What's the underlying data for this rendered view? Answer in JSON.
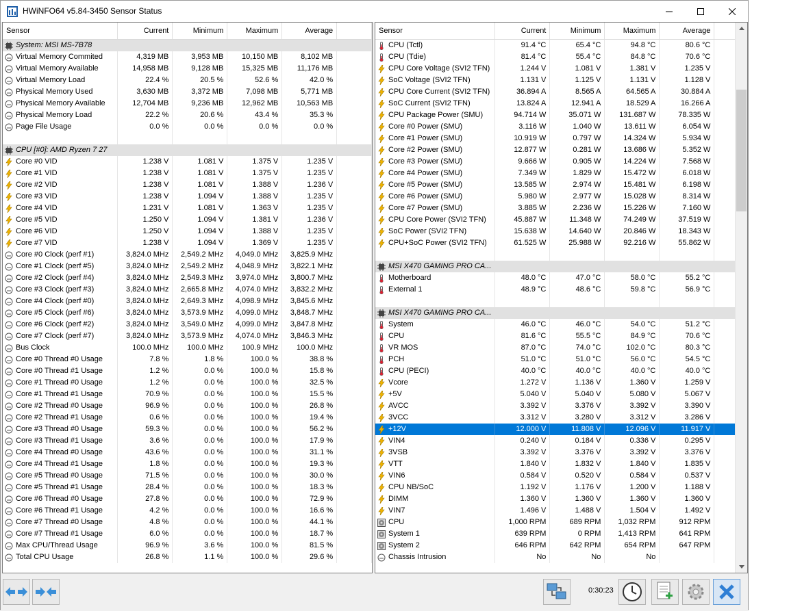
{
  "window": {
    "title": "HWiNFO64 v5.84-3450 Sensor Status",
    "icon": "hwinfo-app-icon",
    "controls": [
      "minimize",
      "maximize",
      "close"
    ]
  },
  "left_panel": {
    "columns": [
      "Sensor",
      "Current",
      "Minimum",
      "Maximum",
      "Average"
    ],
    "rows": [
      {
        "type": "group",
        "icon": "chip",
        "label": "System: MSI MS-7B78"
      },
      {
        "icon": "gauge",
        "label": "Virtual Memory Commited",
        "cur": "4,319 MB",
        "min": "3,953 MB",
        "max": "10,150 MB",
        "avg": "8,102 MB"
      },
      {
        "icon": "gauge",
        "label": "Virtual Memory Available",
        "cur": "14,958 MB",
        "min": "9,128 MB",
        "max": "15,325 MB",
        "avg": "11,176 MB"
      },
      {
        "icon": "gauge",
        "label": "Virtual Memory Load",
        "cur": "22.4 %",
        "min": "20.5 %",
        "max": "52.6 %",
        "avg": "42.0 %"
      },
      {
        "icon": "gauge",
        "label": "Physical Memory Used",
        "cur": "3,630 MB",
        "min": "3,372 MB",
        "max": "7,098 MB",
        "avg": "5,771 MB"
      },
      {
        "icon": "gauge",
        "label": "Physical Memory Available",
        "cur": "12,704 MB",
        "min": "9,236 MB",
        "max": "12,962 MB",
        "avg": "10,563 MB"
      },
      {
        "icon": "gauge",
        "label": "Physical Memory Load",
        "cur": "22.2 %",
        "min": "20.6 %",
        "max": "43.4 %",
        "avg": "35.3 %"
      },
      {
        "icon": "gauge",
        "label": "Page File Usage",
        "cur": "0.0 %",
        "min": "0.0 %",
        "max": "0.0 %",
        "avg": "0.0 %"
      },
      {
        "type": "blank"
      },
      {
        "type": "group",
        "icon": "chip",
        "label": "CPU [#0]: AMD Ryzen 7 27"
      },
      {
        "icon": "bolt",
        "label": "Core #0 VID",
        "cur": "1.238 V",
        "min": "1.081 V",
        "max": "1.375 V",
        "avg": "1.235 V"
      },
      {
        "icon": "bolt",
        "label": "Core #1 VID",
        "cur": "1.238 V",
        "min": "1.081 V",
        "max": "1.375 V",
        "avg": "1.235 V"
      },
      {
        "icon": "bolt",
        "label": "Core #2 VID",
        "cur": "1.238 V",
        "min": "1.081 V",
        "max": "1.388 V",
        "avg": "1.236 V"
      },
      {
        "icon": "bolt",
        "label": "Core #3 VID",
        "cur": "1.238 V",
        "min": "1.094 V",
        "max": "1.388 V",
        "avg": "1.235 V"
      },
      {
        "icon": "bolt",
        "label": "Core #4 VID",
        "cur": "1.231 V",
        "min": "1.081 V",
        "max": "1.363 V",
        "avg": "1.235 V"
      },
      {
        "icon": "bolt",
        "label": "Core #5 VID",
        "cur": "1.250 V",
        "min": "1.094 V",
        "max": "1.381 V",
        "avg": "1.236 V"
      },
      {
        "icon": "bolt",
        "label": "Core #6 VID",
        "cur": "1.250 V",
        "min": "1.094 V",
        "max": "1.388 V",
        "avg": "1.235 V"
      },
      {
        "icon": "bolt",
        "label": "Core #7 VID",
        "cur": "1.238 V",
        "min": "1.094 V",
        "max": "1.369 V",
        "avg": "1.235 V"
      },
      {
        "icon": "gauge",
        "label": "Core #0 Clock (perf #1)",
        "cur": "3,824.0 MHz",
        "min": "2,549.2 MHz",
        "max": "4,049.0 MHz",
        "avg": "3,825.9 MHz"
      },
      {
        "icon": "gauge",
        "label": "Core #1 Clock (perf #5)",
        "cur": "3,824.0 MHz",
        "min": "2,549.2 MHz",
        "max": "4,048.9 MHz",
        "avg": "3,822.1 MHz"
      },
      {
        "icon": "gauge",
        "label": "Core #2 Clock (perf #4)",
        "cur": "3,824.0 MHz",
        "min": "2,549.3 MHz",
        "max": "3,974.0 MHz",
        "avg": "3,800.7 MHz"
      },
      {
        "icon": "gauge",
        "label": "Core #3 Clock (perf #3)",
        "cur": "3,824.0 MHz",
        "min": "2,665.8 MHz",
        "max": "4,074.0 MHz",
        "avg": "3,832.2 MHz"
      },
      {
        "icon": "gauge",
        "label": "Core #4 Clock (perf #0)",
        "cur": "3,824.0 MHz",
        "min": "2,649.3 MHz",
        "max": "4,098.9 MHz",
        "avg": "3,845.6 MHz"
      },
      {
        "icon": "gauge",
        "label": "Core #5 Clock (perf #6)",
        "cur": "3,824.0 MHz",
        "min": "3,573.9 MHz",
        "max": "4,099.0 MHz",
        "avg": "3,848.7 MHz"
      },
      {
        "icon": "gauge",
        "label": "Core #6 Clock (perf #2)",
        "cur": "3,824.0 MHz",
        "min": "3,549.0 MHz",
        "max": "4,099.0 MHz",
        "avg": "3,847.8 MHz"
      },
      {
        "icon": "gauge",
        "label": "Core #7 Clock (perf #7)",
        "cur": "3,824.0 MHz",
        "min": "3,573.9 MHz",
        "max": "4,074.0 MHz",
        "avg": "3,846.3 MHz"
      },
      {
        "icon": "gauge",
        "label": "Bus Clock",
        "cur": "100.0 MHz",
        "min": "100.0 MHz",
        "max": "100.9 MHz",
        "avg": "100.0 MHz"
      },
      {
        "icon": "gauge",
        "label": "Core #0 Thread #0 Usage",
        "cur": "7.8 %",
        "min": "1.8 %",
        "max": "100.0 %",
        "avg": "38.8 %"
      },
      {
        "icon": "gauge",
        "label": "Core #0 Thread #1 Usage",
        "cur": "1.2 %",
        "min": "0.0 %",
        "max": "100.0 %",
        "avg": "15.8 %"
      },
      {
        "icon": "gauge",
        "label": "Core #1 Thread #0 Usage",
        "cur": "1.2 %",
        "min": "0.0 %",
        "max": "100.0 %",
        "avg": "32.5 %"
      },
      {
        "icon": "gauge",
        "label": "Core #1 Thread #1 Usage",
        "cur": "70.9 %",
        "min": "0.0 %",
        "max": "100.0 %",
        "avg": "15.5 %"
      },
      {
        "icon": "gauge",
        "label": "Core #2 Thread #0 Usage",
        "cur": "96.9 %",
        "min": "0.0 %",
        "max": "100.0 %",
        "avg": "26.8 %"
      },
      {
        "icon": "gauge",
        "label": "Core #2 Thread #1 Usage",
        "cur": "0.6 %",
        "min": "0.0 %",
        "max": "100.0 %",
        "avg": "19.4 %"
      },
      {
        "icon": "gauge",
        "label": "Core #3 Thread #0 Usage",
        "cur": "59.3 %",
        "min": "0.0 %",
        "max": "100.0 %",
        "avg": "56.2 %"
      },
      {
        "icon": "gauge",
        "label": "Core #3 Thread #1 Usage",
        "cur": "3.6 %",
        "min": "0.0 %",
        "max": "100.0 %",
        "avg": "17.9 %"
      },
      {
        "icon": "gauge",
        "label": "Core #4 Thread #0 Usage",
        "cur": "43.6 %",
        "min": "0.0 %",
        "max": "100.0 %",
        "avg": "31.1 %"
      },
      {
        "icon": "gauge",
        "label": "Core #4 Thread #1 Usage",
        "cur": "1.8 %",
        "min": "0.0 %",
        "max": "100.0 %",
        "avg": "19.3 %"
      },
      {
        "icon": "gauge",
        "label": "Core #5 Thread #0 Usage",
        "cur": "71.5 %",
        "min": "0.0 %",
        "max": "100.0 %",
        "avg": "30.0 %"
      },
      {
        "icon": "gauge",
        "label": "Core #5 Thread #1 Usage",
        "cur": "28.4 %",
        "min": "0.0 %",
        "max": "100.0 %",
        "avg": "18.3 %"
      },
      {
        "icon": "gauge",
        "label": "Core #6 Thread #0 Usage",
        "cur": "27.8 %",
        "min": "0.0 %",
        "max": "100.0 %",
        "avg": "72.9 %"
      },
      {
        "icon": "gauge",
        "label": "Core #6 Thread #1 Usage",
        "cur": "4.2 %",
        "min": "0.0 %",
        "max": "100.0 %",
        "avg": "16.6 %"
      },
      {
        "icon": "gauge",
        "label": "Core #7 Thread #0 Usage",
        "cur": "4.8 %",
        "min": "0.0 %",
        "max": "100.0 %",
        "avg": "44.1 %"
      },
      {
        "icon": "gauge",
        "label": "Core #7 Thread #1 Usage",
        "cur": "6.0 %",
        "min": "0.0 %",
        "max": "100.0 %",
        "avg": "18.7 %"
      },
      {
        "icon": "gauge",
        "label": "Max CPU/Thread Usage",
        "cur": "96.9 %",
        "min": "3.6 %",
        "max": "100.0 %",
        "avg": "81.5 %"
      },
      {
        "icon": "gauge",
        "label": "Total CPU Usage",
        "cur": "26.8 %",
        "min": "1.1 %",
        "max": "100.0 %",
        "avg": "29.6 %"
      }
    ]
  },
  "right_panel": {
    "columns": [
      "Sensor",
      "Current",
      "Minimum",
      "Maximum",
      "Average"
    ],
    "rows": [
      {
        "icon": "thermo",
        "label": "CPU (Tctl)",
        "cur": "91.4 °C",
        "min": "65.4 °C",
        "max": "94.8 °C",
        "avg": "80.6 °C"
      },
      {
        "icon": "thermo",
        "label": "CPU (Tdie)",
        "cur": "81.4 °C",
        "min": "55.4 °C",
        "max": "84.8 °C",
        "avg": "70.6 °C"
      },
      {
        "icon": "bolt",
        "label": "CPU Core Voltage (SVI2 TFN)",
        "cur": "1.244 V",
        "min": "1.081 V",
        "max": "1.381 V",
        "avg": "1.235 V"
      },
      {
        "icon": "bolt",
        "label": "SoC Voltage (SVI2 TFN)",
        "cur": "1.131 V",
        "min": "1.125 V",
        "max": "1.131 V",
        "avg": "1.128 V"
      },
      {
        "icon": "bolt",
        "label": "CPU Core Current (SVI2 TFN)",
        "cur": "36.894 A",
        "min": "8.565 A",
        "max": "64.565 A",
        "avg": "30.884 A"
      },
      {
        "icon": "bolt",
        "label": "SoC Current (SVI2 TFN)",
        "cur": "13.824 A",
        "min": "12.941 A",
        "max": "18.529 A",
        "avg": "16.266 A"
      },
      {
        "icon": "bolt",
        "label": "CPU Package Power (SMU)",
        "cur": "94.714 W",
        "min": "35.071 W",
        "max": "131.687 W",
        "avg": "78.335 W"
      },
      {
        "icon": "bolt",
        "label": "Core #0 Power (SMU)",
        "cur": "3.116 W",
        "min": "1.040 W",
        "max": "13.611 W",
        "avg": "6.054 W"
      },
      {
        "icon": "bolt",
        "label": "Core #1 Power (SMU)",
        "cur": "10.919 W",
        "min": "0.797 W",
        "max": "14.324 W",
        "avg": "5.934 W"
      },
      {
        "icon": "bolt",
        "label": "Core #2 Power (SMU)",
        "cur": "12.877 W",
        "min": "0.281 W",
        "max": "13.686 W",
        "avg": "5.352 W"
      },
      {
        "icon": "bolt",
        "label": "Core #3 Power (SMU)",
        "cur": "9.666 W",
        "min": "0.905 W",
        "max": "14.224 W",
        "avg": "7.568 W"
      },
      {
        "icon": "bolt",
        "label": "Core #4 Power (SMU)",
        "cur": "7.349 W",
        "min": "1.829 W",
        "max": "15.472 W",
        "avg": "6.018 W"
      },
      {
        "icon": "bolt",
        "label": "Core #5 Power (SMU)",
        "cur": "13.585 W",
        "min": "2.974 W",
        "max": "15.481 W",
        "avg": "6.198 W"
      },
      {
        "icon": "bolt",
        "label": "Core #6 Power (SMU)",
        "cur": "5.980 W",
        "min": "2.977 W",
        "max": "15.028 W",
        "avg": "8.314 W"
      },
      {
        "icon": "bolt",
        "label": "Core #7 Power (SMU)",
        "cur": "3.885 W",
        "min": "2.236 W",
        "max": "15.226 W",
        "avg": "7.160 W"
      },
      {
        "icon": "bolt",
        "label": "CPU Core Power (SVI2 TFN)",
        "cur": "45.887 W",
        "min": "11.348 W",
        "max": "74.249 W",
        "avg": "37.519 W"
      },
      {
        "icon": "bolt",
        "label": "SoC Power (SVI2 TFN)",
        "cur": "15.638 W",
        "min": "14.640 W",
        "max": "20.846 W",
        "avg": "18.343 W"
      },
      {
        "icon": "bolt",
        "label": "CPU+SoC Power (SVI2 TFN)",
        "cur": "61.525 W",
        "min": "25.988 W",
        "max": "92.216 W",
        "avg": "55.862 W"
      },
      {
        "type": "blank"
      },
      {
        "type": "group",
        "icon": "chip",
        "label": "MSI X470 GAMING PRO CA..."
      },
      {
        "icon": "thermo",
        "label": "Motherboard",
        "cur": "48.0 °C",
        "min": "47.0 °C",
        "max": "58.0 °C",
        "avg": "55.2 °C"
      },
      {
        "icon": "thermo",
        "label": "External 1",
        "cur": "48.9 °C",
        "min": "48.6 °C",
        "max": "59.8 °C",
        "avg": "56.9 °C"
      },
      {
        "type": "blank"
      },
      {
        "type": "group",
        "icon": "chip",
        "label": "MSI X470 GAMING PRO CA..."
      },
      {
        "icon": "thermo",
        "label": "System",
        "cur": "46.0 °C",
        "min": "46.0 °C",
        "max": "54.0 °C",
        "avg": "51.2 °C"
      },
      {
        "icon": "thermo",
        "label": "CPU",
        "cur": "81.6 °C",
        "min": "55.5 °C",
        "max": "84.9 °C",
        "avg": "70.6 °C"
      },
      {
        "icon": "thermo",
        "label": "VR MOS",
        "cur": "87.0 °C",
        "min": "74.0 °C",
        "max": "102.0 °C",
        "avg": "80.3 °C"
      },
      {
        "icon": "thermo",
        "label": "PCH",
        "cur": "51.0 °C",
        "min": "51.0 °C",
        "max": "56.0 °C",
        "avg": "54.5 °C"
      },
      {
        "icon": "thermo",
        "label": "CPU (PECI)",
        "cur": "40.0 °C",
        "min": "40.0 °C",
        "max": "40.0 °C",
        "avg": "40.0 °C"
      },
      {
        "icon": "bolt",
        "label": "Vcore",
        "cur": "1.272 V",
        "min": "1.136 V",
        "max": "1.360 V",
        "avg": "1.259 V"
      },
      {
        "icon": "bolt",
        "label": "+5V",
        "cur": "5.040 V",
        "min": "5.040 V",
        "max": "5.080 V",
        "avg": "5.067 V"
      },
      {
        "icon": "bolt",
        "label": "AVCC",
        "cur": "3.392 V",
        "min": "3.376 V",
        "max": "3.392 V",
        "avg": "3.390 V"
      },
      {
        "icon": "bolt",
        "label": "3VCC",
        "cur": "3.312 V",
        "min": "3.280 V",
        "max": "3.312 V",
        "avg": "3.286 V"
      },
      {
        "icon": "bolt",
        "label": "+12V",
        "cur": "12.000 V",
        "min": "11.808 V",
        "max": "12.096 V",
        "avg": "11.917 V",
        "selected": true
      },
      {
        "icon": "bolt",
        "label": "VIN4",
        "cur": "0.240 V",
        "min": "0.184 V",
        "max": "0.336 V",
        "avg": "0.295 V"
      },
      {
        "icon": "bolt",
        "label": "3VSB",
        "cur": "3.392 V",
        "min": "3.376 V",
        "max": "3.392 V",
        "avg": "3.376 V"
      },
      {
        "icon": "bolt",
        "label": "VTT",
        "cur": "1.840 V",
        "min": "1.832 V",
        "max": "1.840 V",
        "avg": "1.835 V"
      },
      {
        "icon": "bolt",
        "label": "VIN6",
        "cur": "0.584 V",
        "min": "0.520 V",
        "max": "0.584 V",
        "avg": "0.537 V"
      },
      {
        "icon": "bolt",
        "label": "CPU NB/SoC",
        "cur": "1.192 V",
        "min": "1.176 V",
        "max": "1.200 V",
        "avg": "1.188 V"
      },
      {
        "icon": "bolt",
        "label": "DIMM",
        "cur": "1.360 V",
        "min": "1.360 V",
        "max": "1.360 V",
        "avg": "1.360 V"
      },
      {
        "icon": "bolt",
        "label": "VIN7",
        "cur": "1.496 V",
        "min": "1.488 V",
        "max": "1.504 V",
        "avg": "1.492 V"
      },
      {
        "icon": "fan",
        "label": "CPU",
        "cur": "1,000 RPM",
        "min": "689 RPM",
        "max": "1,032 RPM",
        "avg": "912 RPM"
      },
      {
        "icon": "fan",
        "label": "System 1",
        "cur": "639 RPM",
        "min": "0 RPM",
        "max": "1,413 RPM",
        "avg": "641 RPM"
      },
      {
        "icon": "fan",
        "label": "System 2",
        "cur": "646 RPM",
        "min": "642 RPM",
        "max": "654 RPM",
        "avg": "647 RPM"
      },
      {
        "icon": "gauge",
        "label": "Chassis Intrusion",
        "cur": "No",
        "min": "No",
        "max": "No",
        "avg": ""
      }
    ]
  },
  "statusbar": {
    "timer": "0:30:23",
    "buttons": [
      "left-right-arrows-icon",
      "collapse-arrows-icon",
      "network-icon",
      "clock-icon",
      "add-report-icon",
      "settings-gear-icon",
      "close-x-icon"
    ]
  },
  "colors": {
    "selection": "#0078d7",
    "group_row": "#e1e1e1",
    "bolt": "#f0b400",
    "close_button": "#2f7fd5"
  }
}
